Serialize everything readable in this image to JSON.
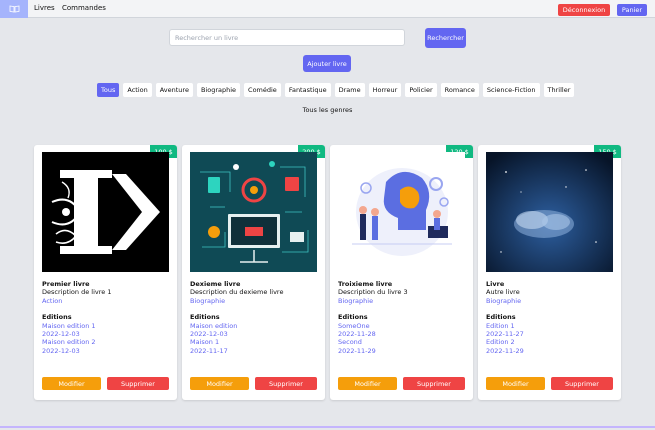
{
  "nav": {
    "books": "Livres",
    "orders": "Commandes",
    "logout": "Déconnexion",
    "cart": "Panier"
  },
  "search": {
    "placeholder": "Rechercher un livre",
    "button": "Rechercher",
    "add_book": "Ajouter livre"
  },
  "genres": [
    "Tous",
    "Action",
    "Aventure",
    "Biographie",
    "Comédie",
    "Fantastique",
    "Drame",
    "Horreur",
    "Policier",
    "Romance",
    "Science-Fiction",
    "Thriller"
  ],
  "selected_genre_index": 0,
  "genre_title": "Tous les genres",
  "books": [
    {
      "price": "100 $",
      "title": "Premier livre",
      "description": "Description de livre 1",
      "genre": "Action",
      "editions_label": "Editions",
      "editions": [
        "Maison edition 1",
        "2022-12-03",
        "Maison edition 2",
        "2022-12-03"
      ],
      "edit": "Modifier",
      "delete": "Supprimer"
    },
    {
      "price": "200 $",
      "title": "Dexieme livre",
      "description": "Description du dexieme livre",
      "genre": "Biographie",
      "editions_label": "Editions",
      "editions": [
        "Maison edition",
        "2022-12-03",
        "Maison 1",
        "2022-11-17"
      ],
      "edit": "Modifier",
      "delete": "Supprimer"
    },
    {
      "price": "120 $",
      "title": "Troixieme livre",
      "description": "Description du livre 3",
      "genre": "Biographie",
      "editions_label": "Editions",
      "editions": [
        "SomeOne",
        "2022-11-28",
        "Second",
        "2022-11-29"
      ],
      "edit": "Modifier",
      "delete": "Supprimer"
    },
    {
      "price": "150 $",
      "title": "Livre",
      "description": "Autre livre",
      "genre": "Biographie",
      "editions_label": "Editions",
      "editions": [
        "Edition 1",
        "2022-11-27",
        "Edition 2",
        "2022-11-29"
      ],
      "edit": "Modifier",
      "delete": "Supprimer"
    }
  ],
  "colors": {
    "accent": "#6366f1",
    "price": "#10b981",
    "edit": "#f59e0b",
    "delete": "#ef4444",
    "background": "#e5e7eb"
  }
}
